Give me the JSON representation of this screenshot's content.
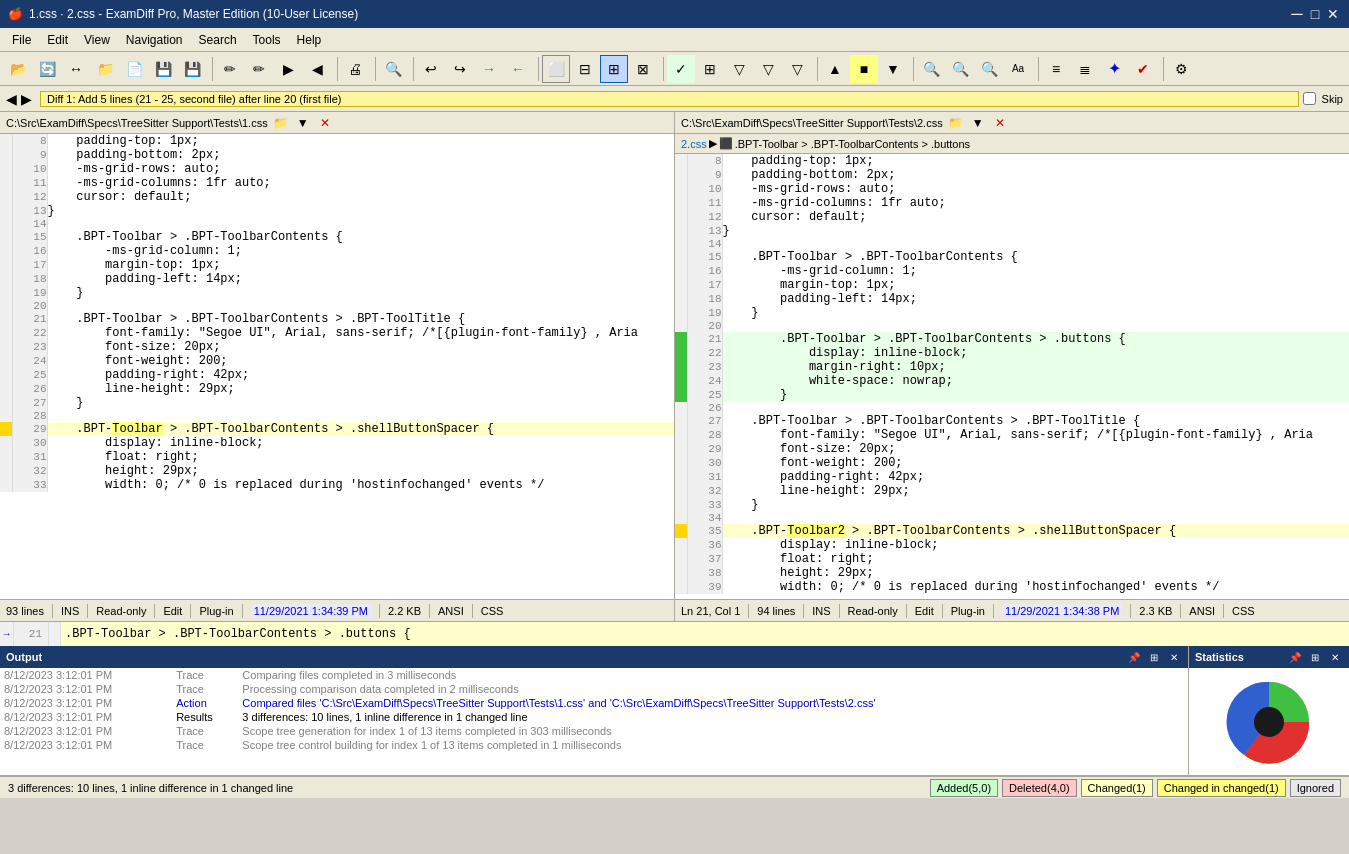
{
  "titlebar": {
    "icon": "🍎",
    "title": "1.css · 2.css - ExamDiff Pro, Master Edition (10-User License)",
    "controls": [
      "─",
      "□",
      "✕"
    ]
  },
  "menubar": {
    "items": [
      "File",
      "Edit",
      "View",
      "Navigation",
      "Search",
      "Tools",
      "Help"
    ]
  },
  "diffbar": {
    "diff_text": "Diff 1: Add 5 lines (21 - 25, second file) after line 20 (first file)",
    "skip_label": "Skip"
  },
  "pane_left": {
    "file_path": "C:\\Src\\ExamDiff\\Specs\\TreeSitter Support\\Tests\\1.css",
    "breadcrumb": "",
    "lines": [
      {
        "num": "8",
        "marker": "",
        "content": "    padding-top: 1px;",
        "class": ""
      },
      {
        "num": "9",
        "marker": "",
        "content": "    padding-bottom: 2px;",
        "class": ""
      },
      {
        "num": "10",
        "marker": "",
        "content": "    -ms-grid-rows: auto;",
        "class": ""
      },
      {
        "num": "11",
        "marker": "",
        "content": "    -ms-grid-columns: 1fr auto;",
        "class": ""
      },
      {
        "num": "12",
        "marker": "",
        "content": "    cursor: default;",
        "class": ""
      },
      {
        "num": "13",
        "marker": "",
        "content": "}",
        "class": ""
      },
      {
        "num": "14",
        "marker": "",
        "content": "",
        "class": ""
      },
      {
        "num": "15",
        "marker": "",
        "content": "    .BPT-Toolbar > .BPT-ToolbarContents {",
        "class": ""
      },
      {
        "num": "16",
        "marker": "",
        "content": "        -ms-grid-column: 1;",
        "class": ""
      },
      {
        "num": "17",
        "marker": "",
        "content": "        margin-top: 1px;",
        "class": ""
      },
      {
        "num": "18",
        "marker": "",
        "content": "        padding-left: 14px;",
        "class": ""
      },
      {
        "num": "19",
        "marker": "",
        "content": "    }",
        "class": ""
      },
      {
        "num": "20",
        "marker": "",
        "content": "",
        "class": ""
      },
      {
        "num": "",
        "marker": "",
        "content": "",
        "class": "diff-gray gap1"
      },
      {
        "num": "",
        "marker": "",
        "content": "",
        "class": "diff-gray gap2"
      },
      {
        "num": "",
        "marker": "",
        "content": "",
        "class": "diff-gray gap3"
      },
      {
        "num": "",
        "marker": "",
        "content": "",
        "class": "diff-gray gap4"
      },
      {
        "num": "",
        "marker": "",
        "content": "",
        "class": "diff-gray gap5"
      },
      {
        "num": "21",
        "marker": "",
        "content": "    .BPT-Toolbar > .BPT-ToolbarContents > .BPT-ToolTitle {",
        "class": ""
      },
      {
        "num": "22",
        "marker": "",
        "content": "        font-family: \"Segoe UI\", Arial, sans-serif; /*[{plugin-font-family} , Aria",
        "class": ""
      },
      {
        "num": "23",
        "marker": "",
        "content": "        font-size: 20px;",
        "class": ""
      },
      {
        "num": "24",
        "marker": "",
        "content": "        font-weight: 200;",
        "class": ""
      },
      {
        "num": "25",
        "marker": "",
        "content": "        padding-right: 42px;",
        "class": ""
      },
      {
        "num": "26",
        "marker": "",
        "content": "        line-height: 29px;",
        "class": ""
      },
      {
        "num": "27",
        "marker": "",
        "content": "    }",
        "class": ""
      },
      {
        "num": "28",
        "marker": "",
        "content": "",
        "class": ""
      },
      {
        "num": "29",
        "marker": "changed",
        "content": "    .BPT-Toolbar > .BPT-ToolbarContents > .shellButtonSpacer {",
        "class": "diff-changed"
      },
      {
        "num": "30",
        "marker": "",
        "content": "        display: inline-block;",
        "class": ""
      },
      {
        "num": "31",
        "marker": "",
        "content": "        float: right;",
        "class": ""
      },
      {
        "num": "32",
        "marker": "",
        "content": "        height: 29px;",
        "class": ""
      },
      {
        "num": "33",
        "marker": "",
        "content": "        width: 0; /* 0 is replaced during 'hostinfochanged' events */",
        "class": ""
      }
    ],
    "status": {
      "lines": "93 lines",
      "ins": "INS",
      "readonly": "Read-only",
      "edit": "Edit",
      "plugin": "Plug-in",
      "date": "11/29/2021 1:34:39 PM",
      "size": "2.2 KB",
      "encoding": "ANSI",
      "type": "CSS"
    }
  },
  "pane_right": {
    "file_path": "C:\\Src\\ExamDiff\\Specs\\TreeSitter Support\\Tests\\2.css",
    "breadcrumb_parts": [
      "2.css",
      ".BPT-Toolbar > .BPT-ToolbarContents > .buttons"
    ],
    "lines": [
      {
        "num": "8",
        "marker": "",
        "content": "    padding-top: 1px;",
        "class": ""
      },
      {
        "num": "9",
        "marker": "",
        "content": "    padding-bottom: 2px;",
        "class": ""
      },
      {
        "num": "10",
        "marker": "",
        "content": "    -ms-grid-rows: auto;",
        "class": ""
      },
      {
        "num": "11",
        "marker": "",
        "content": "    -ms-grid-columns: 1fr auto;",
        "class": ""
      },
      {
        "num": "12",
        "marker": "",
        "content": "    cursor: default;",
        "class": ""
      },
      {
        "num": "13",
        "marker": "",
        "content": "}",
        "class": ""
      },
      {
        "num": "14",
        "marker": "",
        "content": "",
        "class": ""
      },
      {
        "num": "15",
        "marker": "",
        "content": "    .BPT-Toolbar > .BPT-ToolbarContents {",
        "class": ""
      },
      {
        "num": "16",
        "marker": "",
        "content": "        -ms-grid-column: 1;",
        "class": ""
      },
      {
        "num": "17",
        "marker": "",
        "content": "        margin-top: 1px;",
        "class": ""
      },
      {
        "num": "18",
        "marker": "",
        "content": "        padding-left: 14px;",
        "class": ""
      },
      {
        "num": "19",
        "marker": "",
        "content": "    }",
        "class": ""
      },
      {
        "num": "20",
        "marker": "",
        "content": "",
        "class": ""
      },
      {
        "num": "21",
        "marker": "added",
        "content": "        .BPT-Toolbar > .BPT-ToolbarContents > .buttons {",
        "class": "diff-added"
      },
      {
        "num": "22",
        "marker": "added",
        "content": "            display: inline-block;",
        "class": "diff-added"
      },
      {
        "num": "23",
        "marker": "added",
        "content": "            margin-right: 10px;",
        "class": "diff-added"
      },
      {
        "num": "24",
        "marker": "added",
        "content": "            white-space: nowrap;",
        "class": "diff-added"
      },
      {
        "num": "25",
        "marker": "added",
        "content": "        }",
        "class": "diff-added"
      },
      {
        "num": "26",
        "marker": "",
        "content": "",
        "class": ""
      },
      {
        "num": "27",
        "marker": "",
        "content": "    .BPT-Toolbar > .BPT-ToolbarContents > .BPT-ToolTitle {",
        "class": ""
      },
      {
        "num": "28",
        "marker": "",
        "content": "        font-family: \"Segoe UI\", Arial, sans-serif; /*[{plugin-font-family} , Aria",
        "class": ""
      },
      {
        "num": "29",
        "marker": "",
        "content": "        font-size: 20px;",
        "class": ""
      },
      {
        "num": "30",
        "marker": "",
        "content": "        font-weight: 200;",
        "class": ""
      },
      {
        "num": "31",
        "marker": "",
        "content": "        padding-right: 42px;",
        "class": ""
      },
      {
        "num": "32",
        "marker": "",
        "content": "        line-height: 29px;",
        "class": ""
      },
      {
        "num": "33",
        "marker": "",
        "content": "    }",
        "class": ""
      },
      {
        "num": "34",
        "marker": "",
        "content": "",
        "class": ""
      },
      {
        "num": "35",
        "marker": "changed",
        "content": "    .BPT-Toolbar2 > .BPT-ToolbarContents > .shellButtonSpacer {",
        "class": "diff-changed"
      },
      {
        "num": "36",
        "marker": "",
        "content": "        display: inline-block;",
        "class": ""
      },
      {
        "num": "37",
        "marker": "",
        "content": "        float: right;",
        "class": ""
      },
      {
        "num": "38",
        "marker": "",
        "content": "        height: 29px;",
        "class": ""
      },
      {
        "num": "39",
        "marker": "",
        "content": "        width: 0; /* 0 is replaced during 'hostinfochanged' events */",
        "class": ""
      }
    ],
    "status": {
      "position": "Ln 21, Col 1",
      "lines": "94 lines",
      "ins": "INS",
      "readonly": "Read-only",
      "edit": "Edit",
      "plugin": "Plug-in",
      "date": "11/29/2021 1:34:38 PM",
      "size": "2.3 KB",
      "encoding": "ANSI",
      "type": "CSS"
    }
  },
  "inline_diff": {
    "line_num": "21",
    "content": "    .BPT-Toolbar > .BPT-ToolbarContents > .buttons {"
  },
  "output_panel": {
    "title": "Output",
    "logs": [
      {
        "time": "8/12/2023 3:12:01 PM",
        "type": "Trace",
        "color": "gray",
        "message": "Comparing files completed in 3 milliseconds"
      },
      {
        "time": "8/12/2023 3:12:01 PM",
        "type": "Trace",
        "color": "gray",
        "message": "Processing comparison data completed in 2 milliseconds"
      },
      {
        "time": "8/12/2023 3:12:01 PM",
        "type": "Action",
        "color": "blue",
        "message": "Compared files 'C:\\Src\\ExamDiff\\Specs\\TreeSitter Support\\Tests\\1.css' and 'C:\\Src\\ExamDiff\\Specs\\TreeSitter Support\\Tests\\2.css'"
      },
      {
        "time": "8/12/2023 3:12:01 PM",
        "type": "Results",
        "color": "black",
        "message": "3 differences: 10 lines, 1 inline difference in 1 changed line"
      },
      {
        "time": "8/12/2023 3:12:01 PM",
        "type": "Trace",
        "color": "gray",
        "message": "Scope tree generation for index 1 of 13 items completed in 303 milliseconds"
      },
      {
        "time": "8/12/2023 3:12:01 PM",
        "type": "Trace",
        "color": "gray",
        "message": "Scope tree control building for index 1 of 13 items completed in 1 milliseconds"
      }
    ]
  },
  "stats_panel": {
    "title": "Statistics"
  },
  "bottom_bar": {
    "summary": "3 differences: 10 lines, 1 inline difference in 1 changed line",
    "badges": {
      "added": "Added(5,0)",
      "deleted": "Deleted(4,0)",
      "changed": "Changed(1)",
      "changed_in": "Changed in changed(1)",
      "ignored": "Ignored"
    }
  },
  "log_colors": {
    "trace": "#808080",
    "action": "#0000cc",
    "results": "#000000",
    "error": "#cc0000"
  }
}
